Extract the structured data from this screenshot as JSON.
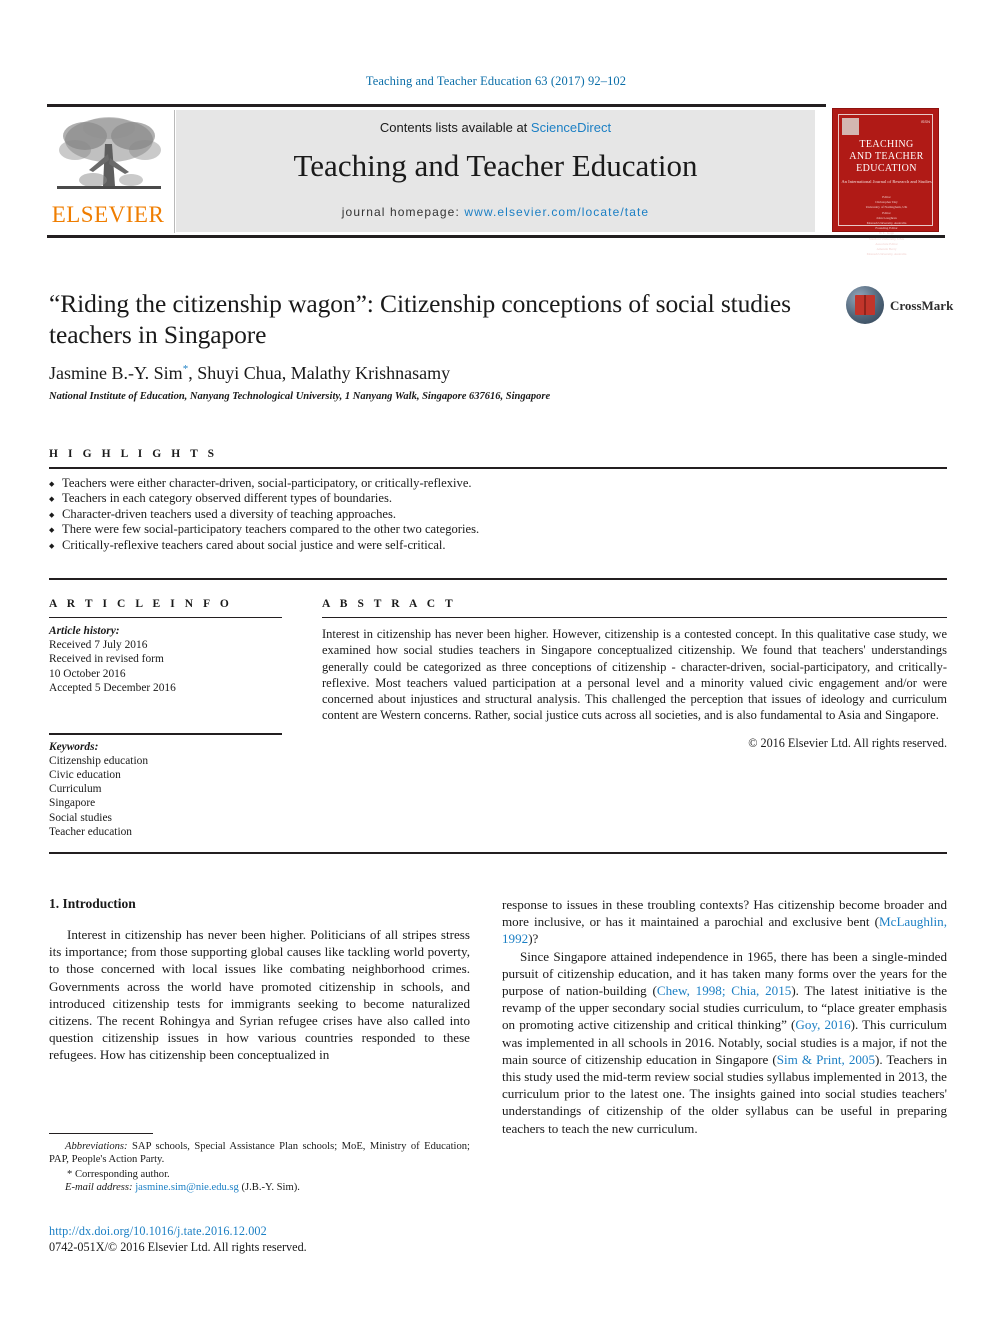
{
  "running_head": "Teaching and Teacher Education 63 (2017) 92–102",
  "masthead": {
    "publisher_name": "ELSEVIER",
    "contents_prefix": "Contents lists available at ",
    "contents_link": "ScienceDirect",
    "journal_title": "Teaching and Teacher Education",
    "homepage_prefix": "journal homepage: ",
    "homepage_url": "www.elsevier.com/locate/tate",
    "cover": {
      "title_line1": "TEACHING",
      "title_line2": "AND TEACHER",
      "title_line3": "EDUCATION",
      "subtitle": "An International Journal of Research and Studies",
      "editors": "Editor\nChristopher Day\nUniversity of Nottingham, UK\n\nEditor\nJohn Loughran\nMonash University, Australia\n\nFounding Editor\nN. L. Gage\nStanford University, USA\n\nAssociate Editor\nAmanda Berry\nMonash University, Australia"
    }
  },
  "article": {
    "title": "“Riding the citizenship wagon”: Citizenship conceptions of social studies teachers in Singapore",
    "authors_html": "Jasmine B.-Y. Sim<sup>*</sup>, Shuyi Chua, Malathy Krishnasamy",
    "affiliation": "National Institute of Education, Nanyang Technological University, 1 Nanyang Walk, Singapore 637616, Singapore",
    "crossmark_label": "CrossMark"
  },
  "highlights": {
    "heading": "H I G H L I G H T S",
    "items": [
      "Teachers were either character-driven, social-participatory, or critically-reflexive.",
      "Teachers in each category observed different types of boundaries.",
      "Character-driven teachers used a diversity of teaching approaches.",
      "There were few social-participatory teachers compared to the other two categories.",
      "Critically-reflexive teachers cared about social justice and were self-critical."
    ]
  },
  "article_info": {
    "heading": "A R T I C L E   I N F O",
    "history_label": "Article history:",
    "history_lines": [
      "Received 7 July 2016",
      "Received in revised form",
      "10 October 2016",
      "Accepted 5 December 2016"
    ],
    "keywords_label": "Keywords:",
    "keywords": [
      "Citizenship education",
      "Civic education",
      "Curriculum",
      "Singapore",
      "Social studies",
      "Teacher education"
    ]
  },
  "abstract": {
    "heading": "A B S T R A C T",
    "text": "Interest in citizenship has never been higher. However, citizenship is a contested concept. In this qualitative case study, we examined how social studies teachers in Singapore conceptualized citizenship. We found that teachers' understandings generally could be categorized as three conceptions of citizenship - character-driven, social-participatory, and critically-reflexive. Most teachers valued participation at a personal level and a minority valued civic engagement and/or were concerned about injustices and structural analysis. This challenged the perception that issues of ideology and curriculum content are Western concerns. Rather, social justice cuts across all societies, and is also fundamental to Asia and Singapore.",
    "copyright": "© 2016 Elsevier Ltd. All rights reserved."
  },
  "body": {
    "section_number_title": "1. Introduction",
    "left_paragraph": "Interest in citizenship has never been higher. Politicians of all stripes stress its importance; from those supporting global causes like tackling world poverty, to those concerned with local issues like combating neighborhood crimes. Governments across the world have promoted citizenship in schools, and introduced citizenship tests for immigrants seeking to become naturalized citizens. The recent Rohingya and Syrian refugee crises have also called into question citizenship issues in how various countries responded to these refugees. How has citizenship been conceptualized in",
    "right_para1_a": "response to issues in these troubling contexts? Has citizenship become broader and more inclusive, or has it maintained a parochial and exclusive bent (",
    "right_para1_ref": "McLaughlin, 1992",
    "right_para1_b": ")?",
    "right_para2_a": "Since Singapore attained independence in 1965, there has been a single-minded pursuit of citizenship education, and it has taken many forms over the years for the purpose of nation-building (",
    "right_para2_ref1": "Chew, 1998; Chia, 2015",
    "right_para2_b": "). The latest initiative is the revamp of the upper secondary social studies curriculum, to “place greater emphasis on promoting active citizenship and critical thinking” (",
    "right_para2_ref2": "Goy, 2016",
    "right_para2_c": "). This curriculum was implemented in all schools in 2016. Notably, social studies is a major, if not the main source of citizenship education in Singapore (",
    "right_para2_ref3": "Sim & Print, 2005",
    "right_para2_d": "). Teachers in this study used the mid-term review social studies syllabus implemented in 2013, the curriculum prior to the latest one. The insights gained into social studies teachers' understandings of citizenship of the older syllabus can be useful in preparing teachers to teach the new curriculum."
  },
  "footnotes": {
    "abbrev_label": "Abbreviations:",
    "abbrev_text": " SAP schools, Special Assistance Plan schools; MoE, Ministry of Education; PAP, People's Action Party.",
    "corresponding": "* Corresponding author.",
    "email_label": "E-mail address:",
    "email": "jasmine.sim@nie.edu.sg",
    "email_suffix": " (J.B.-Y. Sim).",
    "doi": "http://dx.doi.org/10.1016/j.tate.2016.12.002",
    "issn": "0742-051X/© 2016 Elsevier Ltd. All rights reserved."
  },
  "colors": {
    "link_blue": "#1b7fc4",
    "elsevier_orange": "#ef7d00",
    "cover_red": "#b01a16"
  }
}
